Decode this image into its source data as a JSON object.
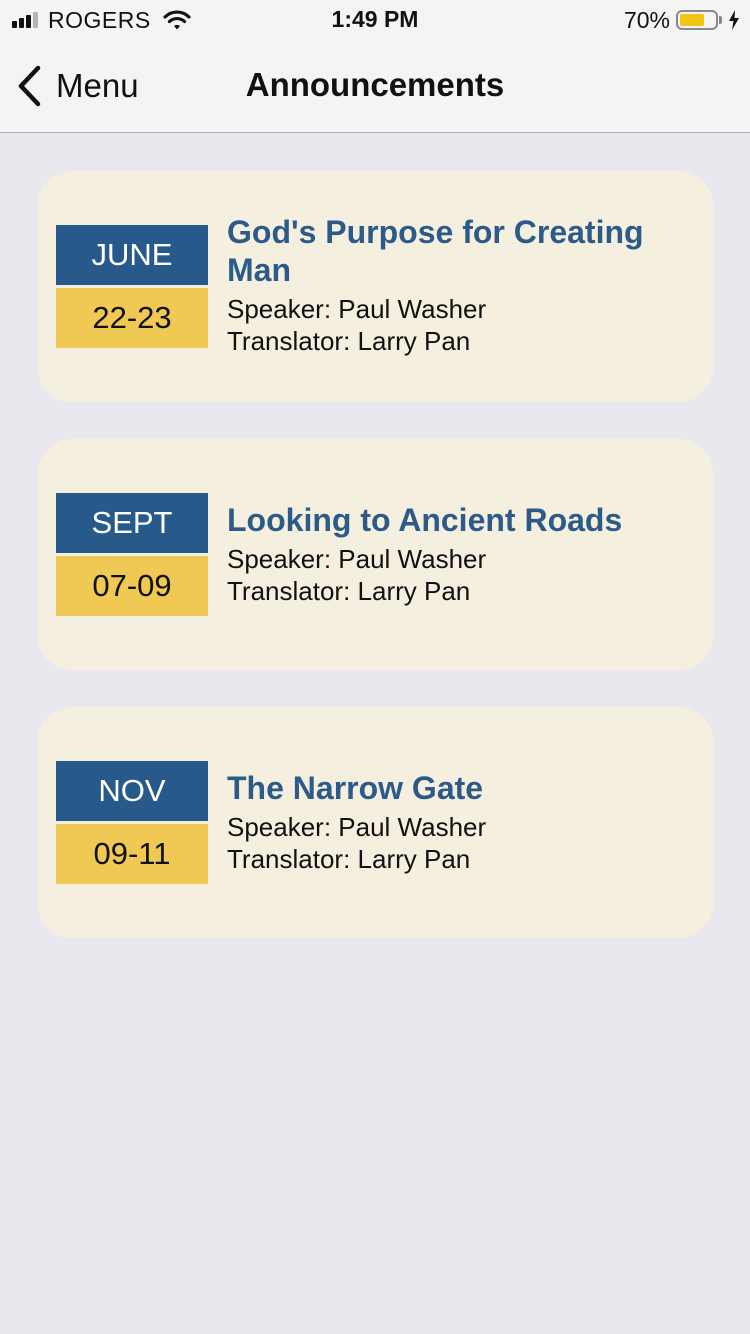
{
  "status_bar": {
    "carrier": "ROGERS",
    "time": "1:49 PM",
    "battery_percent": "70%",
    "battery_level": 0.7,
    "signal_bars_active": 3,
    "signal_bars_total": 4
  },
  "nav": {
    "back_label": "Menu",
    "title": "Announcements"
  },
  "announcements": [
    {
      "month": "JUNE",
      "days": "22-23",
      "title": "God's Purpose for Creating Man",
      "speaker": "Speaker: Paul Washer",
      "translator": "Translator: Larry Pan"
    },
    {
      "month": "SEPT",
      "days": "07-09",
      "title": "Looking to Ancient Roads",
      "speaker": "Speaker: Paul Washer",
      "translator": "Translator: Larry Pan"
    },
    {
      "month": "NOV",
      "days": "09-11",
      "title": "The Narrow Gate",
      "speaker": "Speaker: Paul Washer",
      "translator": "Translator: Larry Pan"
    }
  ],
  "colors": {
    "month_bg": "#275a8b",
    "days_bg": "#efc953",
    "title_text": "#2c5b8a",
    "card_bg": "#f5efe0",
    "battery_fill": "#f2c514"
  },
  "icons": {
    "back": "chevron-left-icon",
    "wifi": "wifi-icon",
    "signal": "cellular-signal-icon",
    "battery": "battery-icon",
    "charging": "charging-bolt-icon"
  }
}
